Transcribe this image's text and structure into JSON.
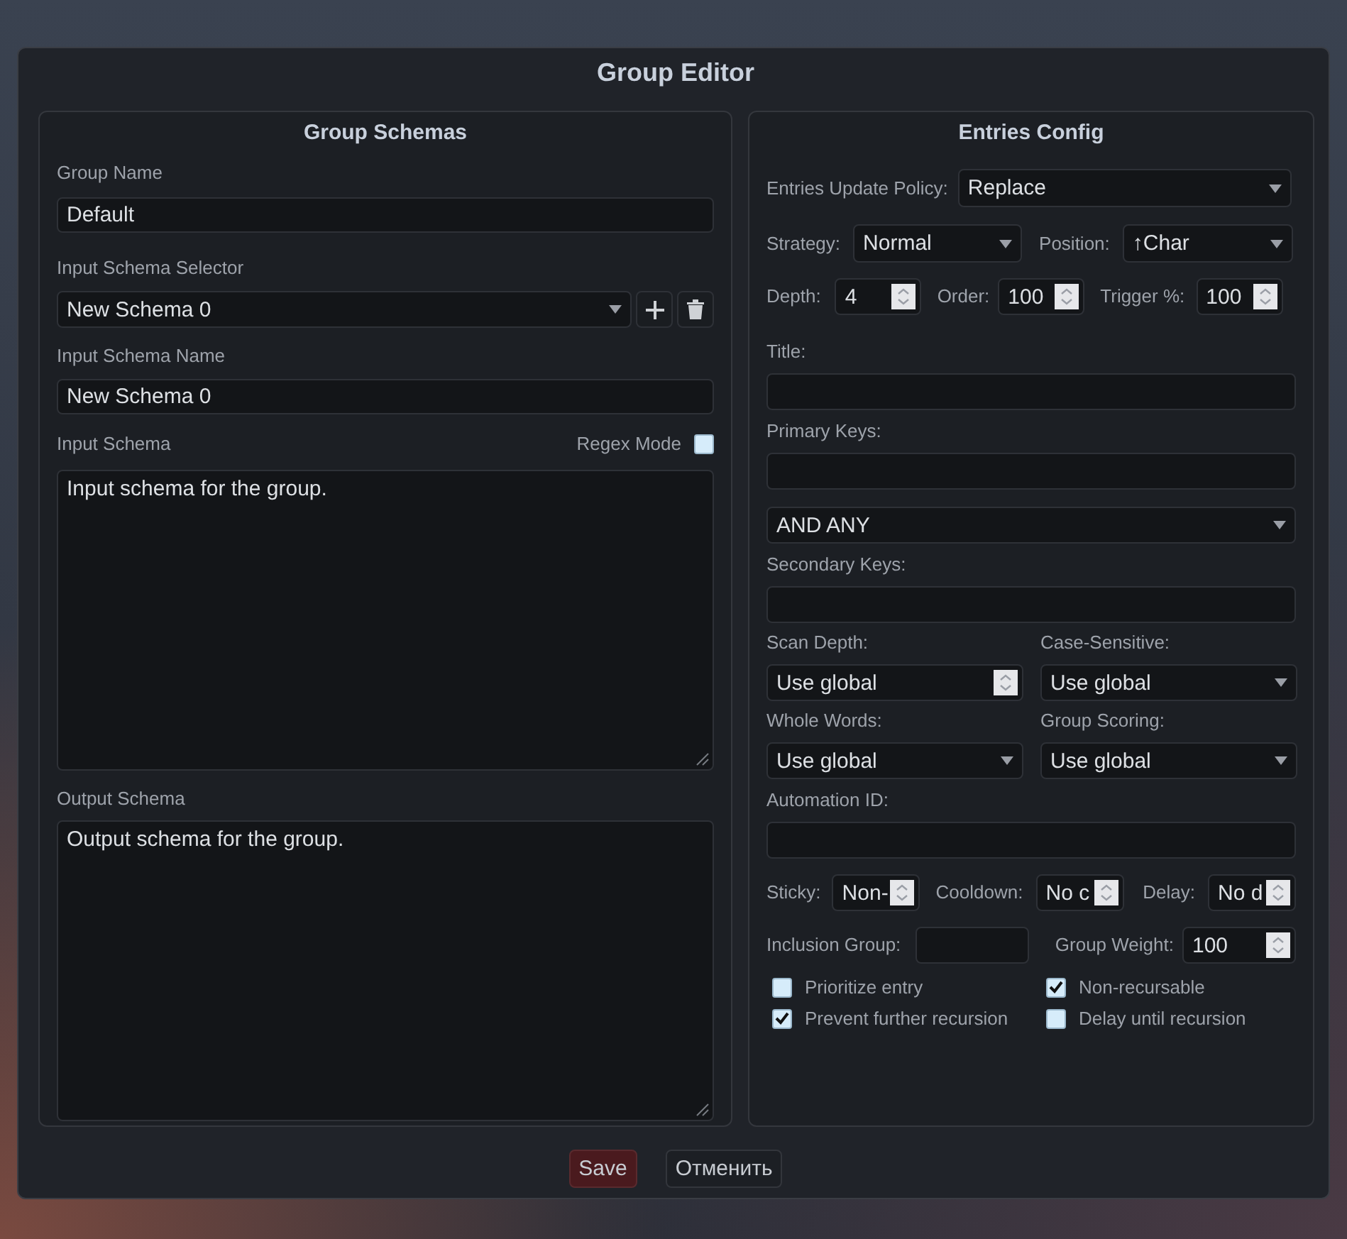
{
  "dialog": {
    "title": "Group Editor"
  },
  "left": {
    "title": "Group Schemas",
    "group_name": {
      "label": "Group Name",
      "value": "Default"
    },
    "schema_selector": {
      "label": "Input Schema Selector",
      "value": "New Schema 0"
    },
    "schema_name": {
      "label": "Input Schema Name",
      "value": "New Schema 0"
    },
    "input_schema": {
      "label": "Input Schema",
      "value": "Input schema for the group.",
      "regex_label": "Regex Mode",
      "regex_checked": false
    },
    "output_schema": {
      "label": "Output Schema",
      "value": "Output schema for the group."
    }
  },
  "right": {
    "title": "Entries Config",
    "update_policy": {
      "label": "Entries Update Policy:",
      "value": "Replace"
    },
    "strategy": {
      "label": "Strategy:",
      "value": "Normal"
    },
    "position": {
      "label": "Position:",
      "value": "↑Char"
    },
    "depth": {
      "label": "Depth:",
      "value": "4"
    },
    "order": {
      "label": "Order:",
      "value": "100"
    },
    "trigger": {
      "label": "Trigger %:",
      "value": "100"
    },
    "title_field": {
      "label": "Title:"
    },
    "primary_keys": {
      "label": "Primary Keys:"
    },
    "logic": {
      "value": "AND ANY"
    },
    "secondary_keys": {
      "label": "Secondary Keys:"
    },
    "scan_depth": {
      "label": "Scan Depth:",
      "value": "Use global"
    },
    "case_sensitive": {
      "label": "Case-Sensitive:",
      "value": "Use global"
    },
    "whole_words": {
      "label": "Whole Words:",
      "value": "Use global"
    },
    "group_scoring": {
      "label": "Group Scoring:",
      "value": "Use global"
    },
    "automation_id": {
      "label": "Automation ID:"
    },
    "sticky": {
      "label": "Sticky:",
      "value": "Non-"
    },
    "cooldown": {
      "label": "Cooldown:",
      "value": "No c"
    },
    "delay": {
      "label": "Delay:",
      "value": "No d"
    },
    "inclusion_group": {
      "label": "Inclusion Group:"
    },
    "group_weight": {
      "label": "Group Weight:",
      "value": "100"
    },
    "checkboxes": [
      {
        "label": "Prioritize entry",
        "checked": false
      },
      {
        "label": "Non-recursable",
        "checked": true
      },
      {
        "label": "Prevent further recursion",
        "checked": true
      },
      {
        "label": "Delay until recursion",
        "checked": false
      }
    ]
  },
  "buttons": [
    {
      "label": "Save",
      "kind": "primary"
    },
    {
      "label": "Отменить",
      "kind": "secondary"
    }
  ]
}
